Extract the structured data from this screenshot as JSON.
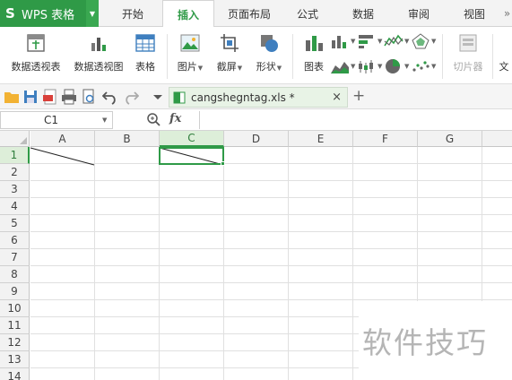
{
  "app": {
    "logo_glyph": "S",
    "name": "WPS 表格"
  },
  "menu_tabs": [
    "开始",
    "插入",
    "页面布局",
    "公式",
    "数据",
    "审阅",
    "视图"
  ],
  "active_tab": "插入",
  "ribbon": {
    "pivot_table": "数据透视表",
    "pivot_chart": "数据透视图",
    "table": "表格",
    "picture": "图片",
    "screenshot": "截屏",
    "shape": "形状",
    "chart": "图表",
    "slicer": "切片器",
    "text_partial": "文"
  },
  "document": {
    "tab_name": "cangshegntag.xls *",
    "close_glyph": "×",
    "new_tab_glyph": "+"
  },
  "formula_bar": {
    "name_box": "C1",
    "fx_label": "fx",
    "formula": ""
  },
  "grid": {
    "columns": [
      "A",
      "B",
      "C",
      "D",
      "E",
      "F",
      "G"
    ],
    "rows": [
      "1",
      "2",
      "3",
      "4",
      "5",
      "6",
      "7",
      "8",
      "9",
      "10",
      "11",
      "12",
      "13",
      "14"
    ],
    "selected_cell": "C1"
  },
  "watermark": "软件技巧",
  "colors": {
    "accent": "#2f9a47",
    "selection": "#2f9a47"
  }
}
